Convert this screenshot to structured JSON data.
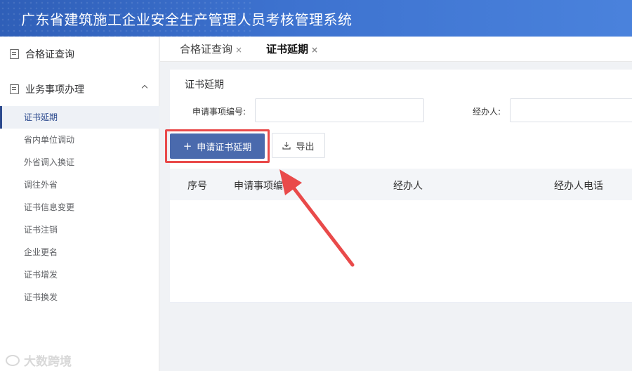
{
  "app": {
    "title": "广东省建筑施工企业安全生产管理人员考核管理系统"
  },
  "sidebar": {
    "menu_query": {
      "label": "合格证查询",
      "icon": "document-icon"
    },
    "menu_business": {
      "label": "业务事项办理",
      "icon": "document-icon",
      "expanded": true
    },
    "items": [
      {
        "label": "证书延期",
        "active": true
      },
      {
        "label": "省内单位调动"
      },
      {
        "label": "外省调入换证"
      },
      {
        "label": "调往外省"
      },
      {
        "label": "证书信息变更"
      },
      {
        "label": "证书注销"
      },
      {
        "label": "企业更名"
      },
      {
        "label": "证书增发"
      },
      {
        "label": "证书换发"
      }
    ]
  },
  "tabs": [
    {
      "label": "合格证查询",
      "close": "×",
      "active": false
    },
    {
      "label": "证书延期",
      "close": "×",
      "active": true
    }
  ],
  "panel": {
    "title": "证书延期",
    "filters": [
      {
        "label": "申请事项编号:",
        "value": ""
      },
      {
        "label": "经办人:",
        "value": ""
      }
    ],
    "actions": {
      "apply_icon": "+",
      "apply_label": "申请证书延期",
      "export_label": "导出"
    },
    "table": {
      "columns": [
        "序号",
        "申请事项编号",
        "经办人",
        "经办人电话"
      ]
    }
  },
  "watermark": {
    "text": "大数跨境"
  },
  "colors": {
    "header": "#3d72cf",
    "primary": "#4a6aad",
    "annotation": "#e94a4a"
  }
}
